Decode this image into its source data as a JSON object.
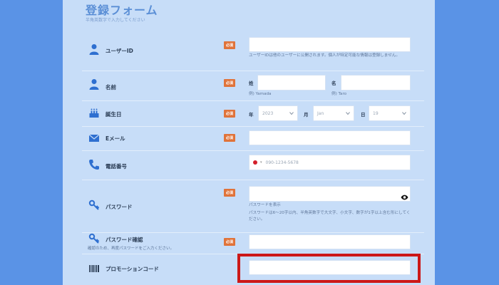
{
  "header": {
    "title": "登録フォーム",
    "subtitle": "半角英数字で入力してください"
  },
  "required_label": "必須",
  "fields": {
    "user_id": {
      "label": "ユーザーID",
      "help": "ユーザーIDは他のユーザーに公開されます。個人が特定可能な情報は登録しません。",
      "value": ""
    },
    "name": {
      "label": "名前",
      "last_prefix": "姓",
      "first_prefix": "名",
      "last_example": "例) Yamada",
      "first_example": "例) Taro",
      "last_value": "",
      "first_value": ""
    },
    "birthday": {
      "label": "誕生日",
      "year_prefix": "年",
      "month_prefix": "月",
      "day_prefix": "日",
      "year_value": "2023",
      "month_value": "Jan",
      "day_value": "19"
    },
    "email": {
      "label": "Eメール",
      "value": ""
    },
    "phone": {
      "label": "電話番号",
      "placeholder": "090-1234-5678",
      "caret": "▾"
    },
    "password": {
      "label": "パスワード",
      "show_hint": "パスワードを表示",
      "help": "パスワードは6〜20字以内、半角英数字で大文字、小文字、数字が1字以上含む形にしてください。",
      "value": ""
    },
    "password_confirm": {
      "label": "パスワード確認",
      "help": "確認のため、再度パスワードをご入力ください。",
      "value": ""
    },
    "promo_code": {
      "label": "プロモーションコード",
      "value": ""
    }
  },
  "colors": {
    "background": "#5a93e6",
    "panel": "#c7ddf8",
    "badge": "#e0733a",
    "highlight": "#cc1818",
    "title": "#5b8fd6"
  }
}
